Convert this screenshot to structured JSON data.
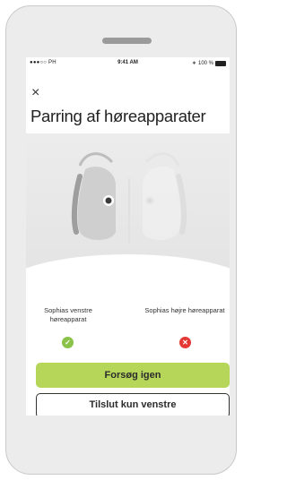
{
  "status_bar": {
    "carrier": "●●●○○ PH",
    "time": "9:41 AM",
    "battery": "100 %"
  },
  "header": {
    "close_icon": "close-icon",
    "title": "Parring af høreapparater"
  },
  "devices": {
    "left": {
      "label": "Sophias venstre høreapparat",
      "status": "success",
      "status_color": "#8bc34a"
    },
    "right": {
      "label": "Sophias højre høreapparat",
      "status": "error",
      "status_color": "#e53935"
    }
  },
  "actions": {
    "retry_label": "Forsøg igen",
    "connect_left_only_label": "Tilslut kun venstre"
  },
  "colors": {
    "accent": "#b6d65a"
  }
}
